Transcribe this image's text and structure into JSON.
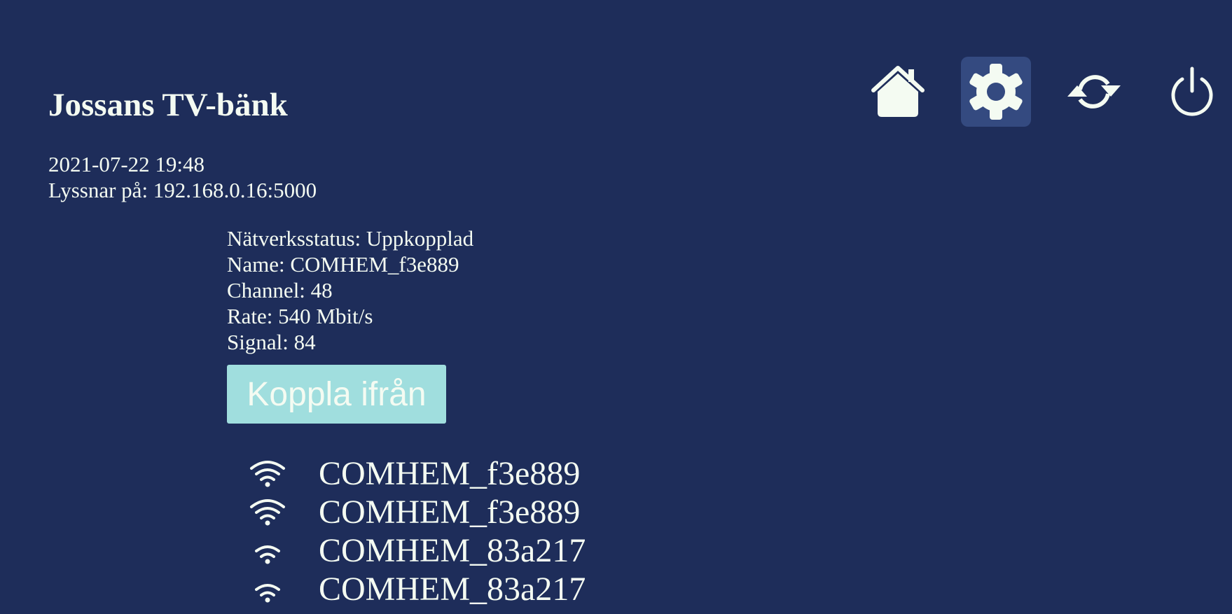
{
  "header": {
    "title": "Jossans TV-bänk",
    "datetime": "2021-07-22 19:48",
    "listening": "Lyssnar på: 192.168.0.16:5000"
  },
  "toolbar": {
    "items": [
      {
        "icon": "home-icon",
        "active": false
      },
      {
        "icon": "gear-icon",
        "active": true
      },
      {
        "icon": "refresh-icon",
        "active": false
      },
      {
        "icon": "power-icon",
        "active": false
      }
    ]
  },
  "network": {
    "status": "Nätverksstatus: Uppkopplad",
    "name": "Name: COMHEM_f3e889",
    "channel": "Channel: 48",
    "rate": "Rate: 540 Mbit/s",
    "signal": "Signal: 84",
    "disconnect_label": "Koppla ifrån"
  },
  "wifi_networks": [
    {
      "name": "COMHEM_f3e889",
      "strength_bars": 3
    },
    {
      "name": "COMHEM_f3e889",
      "strength_bars": 3
    },
    {
      "name": "COMHEM_83a217",
      "strength_bars": 2
    },
    {
      "name": "COMHEM_83a217",
      "strength_bars": 2
    }
  ],
  "colors": {
    "background": "#1e2d5a",
    "foreground": "#f4fbf2",
    "active_tool": "#344a80",
    "button": "#a0dede"
  }
}
